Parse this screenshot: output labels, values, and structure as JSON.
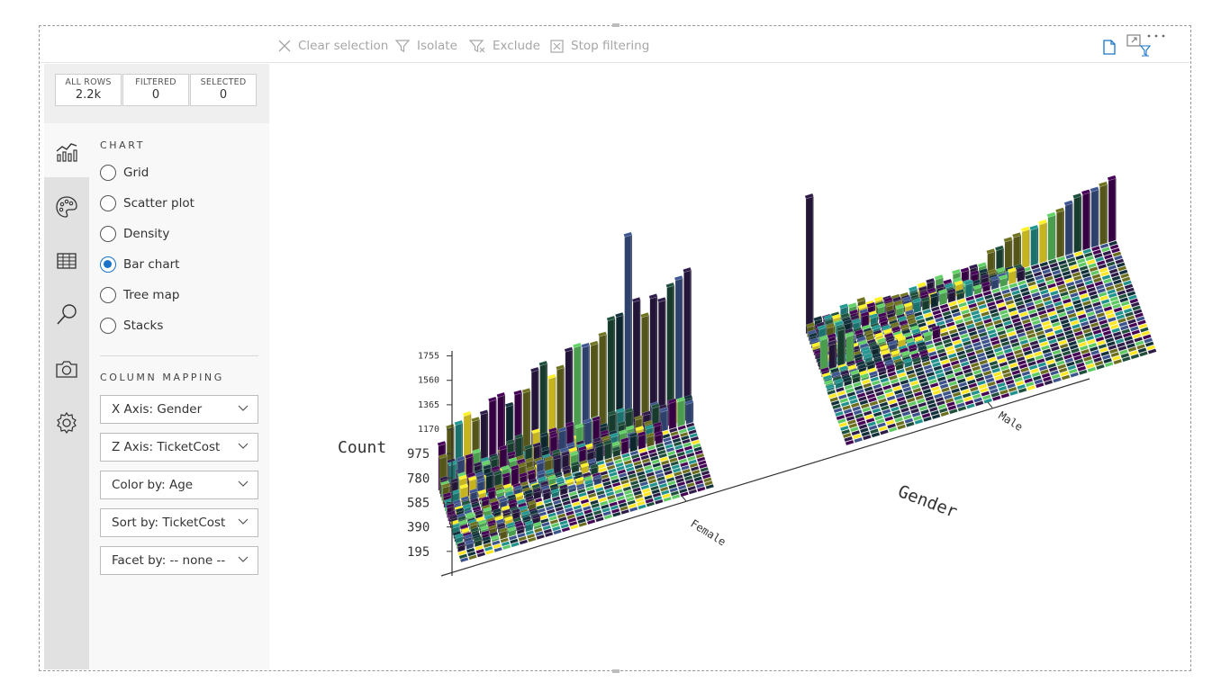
{
  "toolbar": {
    "items": [
      {
        "label": "Clear selection",
        "icon": "close-icon"
      },
      {
        "label": "Isolate",
        "icon": "filter-icon"
      },
      {
        "label": "Exclude",
        "icon": "filter-exclude-icon"
      },
      {
        "label": "Stop filtering",
        "icon": "stop-filter-icon"
      }
    ],
    "visual_icons": [
      "page-icon",
      "focus-mode-icon",
      "more-options-icon"
    ]
  },
  "counts": [
    {
      "label": "ALL ROWS",
      "value": "2.2k"
    },
    {
      "label": "FILTERED",
      "value": "0"
    },
    {
      "label": "SELECTED",
      "value": "0"
    }
  ],
  "sidebar_icons": [
    "chart-icon",
    "palette-icon",
    "table-icon",
    "search-icon",
    "camera-icon",
    "gear-icon"
  ],
  "panel": {
    "chart_title": "CHART",
    "chart_options": [
      {
        "label": "Grid",
        "checked": false
      },
      {
        "label": "Scatter plot",
        "checked": false
      },
      {
        "label": "Density",
        "checked": false
      },
      {
        "label": "Bar chart",
        "checked": true
      },
      {
        "label": "Tree map",
        "checked": false
      },
      {
        "label": "Stacks",
        "checked": false
      }
    ],
    "mapping_title": "COLUMN MAPPING",
    "dropdowns": [
      {
        "label": "X Axis: Gender"
      },
      {
        "label": "Z Axis: TicketCost"
      },
      {
        "label": "Color by: Age"
      },
      {
        "label": "Sort by: TicketCost"
      },
      {
        "label": "Facet by: -- none --"
      }
    ]
  },
  "chart_data": {
    "type": "bar",
    "ylabel": "Count",
    "xlabel": "Gender",
    "categories": [
      "Female",
      "Male"
    ],
    "y_ticks": [
      195,
      390,
      585,
      780,
      975,
      1170,
      1365,
      1560,
      1755
    ],
    "colormap": "viridis",
    "colors": [
      "#440154",
      "#3b528b",
      "#21918c",
      "#5ec962",
      "#fde725",
      "#2d1b47",
      "#1e4d3a",
      "#6b6e1f",
      "#11303a"
    ]
  }
}
